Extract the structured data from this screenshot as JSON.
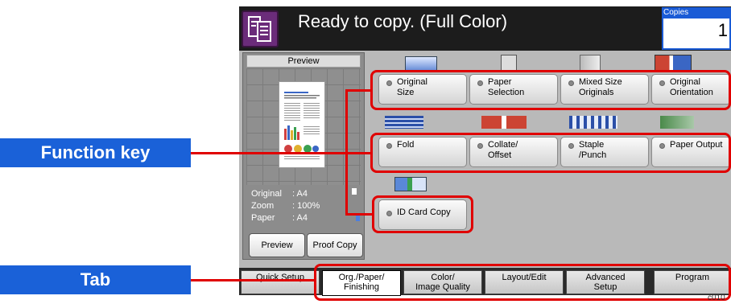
{
  "header": {
    "title": "Ready to copy. (Full Color)",
    "copies_label": "Copies",
    "copies_value": "1"
  },
  "preview": {
    "label": "Preview",
    "info": [
      {
        "key": "Original",
        "value": ": A4"
      },
      {
        "key": "Zoom",
        "value": ": 100%"
      },
      {
        "key": "Paper",
        "value": ": A4"
      }
    ],
    "preview_button": "Preview",
    "proof_button": "Proof Copy"
  },
  "function_keys": {
    "original_size": "Original\nSize",
    "paper_selection": "Paper\nSelection",
    "mixed_size": "Mixed Size\nOriginals",
    "original_orientation": "Original\nOrientation",
    "fold": "Fold",
    "collate_offset": "Collate/\nOffset",
    "staple_punch": "Staple\n/Punch",
    "paper_output": "Paper Output",
    "id_card_copy": "ID Card Copy"
  },
  "tabs": [
    "Quick Setup",
    "Org./Paper/\nFinishing",
    "Color/\nImage Quality",
    "Layout/Edit",
    "Advanced\nSetup",
    "Program"
  ],
  "callouts": {
    "function_key": "Function key",
    "tab": "Tab"
  },
  "figure_code": "c010",
  "colors": {
    "callout_blue": "#1a61d8",
    "highlight_red": "#e00000",
    "header_black": "#1c1c1c"
  }
}
